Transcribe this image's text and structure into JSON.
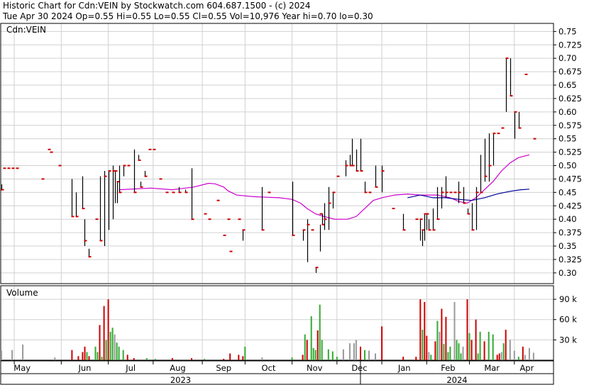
{
  "header": {
    "line1": "Historic Chart for Cdn:VEIN by Stockwatch.com 604.687.1500 - (c) 2024",
    "line2": "Tue Apr 30 2024  Op=0.55  Hi=0.55  Lo=0.55  Cl=0.55  Vol=10,976  Year hi=0.70  lo=0.30"
  },
  "chart_data": {
    "type": "ohlc",
    "symbol_label": "Cdn:VEIN",
    "volume_label": "Volume",
    "price_ylim": [
      0.28,
      0.765
    ],
    "price_ticks": [
      0.75,
      0.725,
      0.7,
      0.675,
      0.65,
      0.625,
      0.6,
      0.575,
      0.55,
      0.525,
      0.5,
      0.475,
      0.45,
      0.425,
      0.4,
      0.375,
      0.35,
      0.325,
      0.3
    ],
    "price_tick_labels": [
      "0.75",
      "0.725",
      "0.70",
      "0.675",
      "0.65",
      "0.625",
      "0.60",
      "0.575",
      "0.55",
      "0.525",
      "0.50",
      "0.475",
      "0.45",
      "0.425",
      "0.40",
      "0.375",
      "0.35",
      "0.325",
      "0.30"
    ],
    "volume_ylim": [
      0,
      110000
    ],
    "volume_ticks": [
      90000,
      60000,
      30000
    ],
    "volume_tick_labels": [
      "90 k",
      "60 k",
      "30 k"
    ],
    "month_labels": [
      "May",
      "Jun",
      "Jul",
      "Aug",
      "Sep",
      "Oct",
      "Nov",
      "Dec",
      "Jan",
      "Feb",
      "Mar",
      "Apr"
    ],
    "year_labels": [
      "2023",
      "2024"
    ],
    "colors": {
      "up_close": "#cc0000",
      "price_bar": "#000000",
      "ma_short": "#cc00cc",
      "ma_long": "#000099",
      "vol_up": "#33aa33",
      "vol_down": "#cc0000",
      "vol_flat": "#999999",
      "grid": "#d0d0d0"
    },
    "x_range": [
      0,
      258
    ],
    "month_starts": [
      6,
      28,
      50,
      71,
      94,
      114,
      136,
      157,
      178,
      199,
      219,
      240
    ],
    "year_boundary_index": 168,
    "ohlc": [
      [
        0,
        0.465,
        0.455,
        0.455
      ],
      [
        1,
        0.495,
        0.495,
        0.495
      ],
      [
        3,
        0.495,
        0.495,
        0.495
      ],
      [
        5,
        0.495,
        0.495,
        0.495
      ],
      [
        7,
        0.495,
        0.495,
        0.495
      ],
      [
        19,
        0.475,
        0.475,
        0.475
      ],
      [
        22,
        0.53,
        0.53,
        0.53
      ],
      [
        23,
        0.525,
        0.525,
        0.525
      ],
      [
        27,
        0.5,
        0.5,
        0.5
      ],
      [
        33,
        0.475,
        0.405,
        0.405
      ],
      [
        35,
        0.45,
        0.405,
        0.405
      ],
      [
        38,
        0.48,
        0.42,
        0.42
      ],
      [
        39,
        0.4,
        0.35,
        0.36
      ],
      [
        41,
        0.345,
        0.33,
        0.33
      ],
      [
        44,
        0.4,
        0.4,
        0.4
      ],
      [
        46,
        0.48,
        0.36,
        0.36
      ],
      [
        48,
        0.49,
        0.35,
        0.48
      ],
      [
        50,
        0.49,
        0.38,
        0.49
      ],
      [
        52,
        0.5,
        0.4,
        0.49
      ],
      [
        53,
        0.49,
        0.43,
        0.49
      ],
      [
        54,
        0.47,
        0.43,
        0.47
      ],
      [
        55,
        0.5,
        0.45,
        0.45
      ],
      [
        57,
        0.5,
        0.48,
        0.5
      ],
      [
        59,
        0.5,
        0.5,
        0.5
      ],
      [
        62,
        0.53,
        0.45,
        0.45
      ],
      [
        64,
        0.52,
        0.51,
        0.51
      ],
      [
        65,
        0.47,
        0.46,
        0.46
      ],
      [
        67,
        0.49,
        0.48,
        0.48
      ],
      [
        69,
        0.53,
        0.53,
        0.53
      ],
      [
        71,
        0.53,
        0.53,
        0.53
      ],
      [
        74,
        0.475,
        0.475,
        0.475
      ],
      [
        77,
        0.45,
        0.45,
        0.45
      ],
      [
        80,
        0.45,
        0.45,
        0.45
      ],
      [
        83,
        0.46,
        0.45,
        0.45
      ],
      [
        86,
        0.455,
        0.45,
        0.45
      ],
      [
        89,
        0.495,
        0.4,
        0.4
      ],
      [
        95,
        0.41,
        0.41,
        0.41
      ],
      [
        97,
        0.4,
        0.4,
        0.4
      ],
      [
        101,
        0.435,
        0.435,
        0.435
      ],
      [
        104,
        0.37,
        0.37,
        0.37
      ],
      [
        106,
        0.4,
        0.4,
        0.4
      ],
      [
        107,
        0.34,
        0.34,
        0.34
      ],
      [
        111,
        0.4,
        0.4,
        0.4
      ],
      [
        113,
        0.38,
        0.36,
        0.38
      ],
      [
        122,
        0.46,
        0.38,
        0.38
      ],
      [
        125,
        0.45,
        0.45,
        0.45
      ],
      [
        136,
        0.47,
        0.37,
        0.37
      ],
      [
        141,
        0.38,
        0.36,
        0.38
      ],
      [
        143,
        0.4,
        0.32,
        0.39
      ],
      [
        145,
        0.38,
        0.38,
        0.38
      ],
      [
        147,
        0.31,
        0.3,
        0.31
      ],
      [
        149,
        0.39,
        0.34,
        0.41
      ],
      [
        150,
        0.41,
        0.39,
        0.39
      ],
      [
        151,
        0.43,
        0.38,
        0.4
      ],
      [
        153,
        0.46,
        0.38,
        0.43
      ],
      [
        155,
        0.45,
        0.42,
        0.45
      ],
      [
        157,
        0.48,
        0.48,
        0.48
      ],
      [
        161,
        0.51,
        0.48,
        0.5
      ],
      [
        163,
        0.52,
        0.5,
        0.5
      ],
      [
        164,
        0.55,
        0.5,
        0.5
      ],
      [
        166,
        0.53,
        0.49,
        0.49
      ],
      [
        168,
        0.55,
        0.49,
        0.49
      ],
      [
        170,
        0.47,
        0.45,
        0.45
      ],
      [
        172,
        0.45,
        0.45,
        0.45
      ],
      [
        175,
        0.5,
        0.46,
        0.46
      ],
      [
        178,
        0.5,
        0.45,
        0.49
      ],
      [
        183,
        0.42,
        0.42,
        0.42
      ],
      [
        188,
        0.41,
        0.38,
        0.38
      ],
      [
        194,
        0.4,
        0.4,
        0.4
      ],
      [
        196,
        0.4,
        0.36,
        0.4
      ],
      [
        197,
        0.38,
        0.35,
        0.38
      ],
      [
        198,
        0.41,
        0.36,
        0.41
      ],
      [
        199,
        0.41,
        0.38,
        0.41
      ],
      [
        200,
        0.4,
        0.38,
        0.38
      ],
      [
        202,
        0.42,
        0.38,
        0.38
      ],
      [
        204,
        0.46,
        0.4,
        0.4
      ],
      [
        206,
        0.46,
        0.42,
        0.45
      ],
      [
        208,
        0.48,
        0.44,
        0.45
      ],
      [
        210,
        0.45,
        0.45,
        0.45
      ],
      [
        212,
        0.45,
        0.45,
        0.45
      ],
      [
        214,
        0.47,
        0.43,
        0.45
      ],
      [
        216,
        0.46,
        0.43,
        0.43
      ],
      [
        218,
        0.42,
        0.41,
        0.41
      ],
      [
        220,
        0.43,
        0.38,
        0.38
      ],
      [
        222,
        0.46,
        0.38,
        0.45
      ],
      [
        224,
        0.52,
        0.45,
        0.45
      ],
      [
        226,
        0.55,
        0.47,
        0.48
      ],
      [
        228,
        0.56,
        0.47,
        0.5
      ],
      [
        230,
        0.56,
        0.5,
        0.56
      ],
      [
        232,
        0.56,
        0.56,
        0.56
      ],
      [
        234,
        0.57,
        0.57,
        0.57
      ],
      [
        236,
        0.7,
        0.6,
        0.7
      ],
      [
        238,
        0.7,
        0.63,
        0.63
      ],
      [
        240,
        0.6,
        0.55,
        0.6
      ],
      [
        242,
        0.6,
        0.57,
        0.57
      ],
      [
        245,
        0.67,
        0.67,
        0.67
      ],
      [
        249,
        0.55,
        0.55,
        0.55
      ]
    ],
    "ma_short": [
      [
        55,
        0.455
      ],
      [
        70,
        0.458
      ],
      [
        80,
        0.455
      ],
      [
        90,
        0.46
      ],
      [
        97,
        0.467
      ],
      [
        100,
        0.466
      ],
      [
        104,
        0.46
      ],
      [
        106,
        0.453
      ],
      [
        110,
        0.445
      ],
      [
        118,
        0.442
      ],
      [
        130,
        0.44
      ],
      [
        136,
        0.437
      ],
      [
        140,
        0.43
      ],
      [
        143,
        0.42
      ],
      [
        147,
        0.41
      ],
      [
        151,
        0.405
      ],
      [
        156,
        0.4
      ],
      [
        162,
        0.4
      ],
      [
        166,
        0.405
      ],
      [
        170,
        0.42
      ],
      [
        174,
        0.435
      ],
      [
        178,
        0.44
      ],
      [
        184,
        0.445
      ],
      [
        190,
        0.447
      ],
      [
        196,
        0.445
      ],
      [
        204,
        0.445
      ],
      [
        210,
        0.44
      ],
      [
        214,
        0.433
      ],
      [
        218,
        0.43
      ],
      [
        222,
        0.44
      ],
      [
        226,
        0.455
      ],
      [
        230,
        0.47
      ],
      [
        234,
        0.49
      ],
      [
        238,
        0.505
      ],
      [
        242,
        0.515
      ],
      [
        247,
        0.52
      ]
    ],
    "ma_long": [
      [
        190,
        0.44
      ],
      [
        196,
        0.445
      ],
      [
        202,
        0.44
      ],
      [
        208,
        0.44
      ],
      [
        214,
        0.437
      ],
      [
        220,
        0.435
      ],
      [
        226,
        0.44
      ],
      [
        232,
        0.447
      ],
      [
        238,
        0.452
      ],
      [
        243,
        0.455
      ],
      [
        247,
        0.456
      ]
    ],
    "volume": [
      [
        0,
        14000,
        "flat"
      ],
      [
        5,
        15000,
        "flat"
      ],
      [
        10,
        23000,
        "flat"
      ],
      [
        25,
        4000,
        "flat"
      ],
      [
        33,
        15000,
        "down"
      ],
      [
        36,
        6000,
        "down"
      ],
      [
        38,
        12000,
        "down"
      ],
      [
        39,
        20000,
        "down"
      ],
      [
        40,
        12000,
        "up"
      ],
      [
        41,
        6000,
        "down"
      ],
      [
        44,
        20000,
        "up"
      ],
      [
        45,
        12000,
        "up"
      ],
      [
        46,
        52000,
        "down"
      ],
      [
        47,
        5000,
        "up"
      ],
      [
        48,
        80000,
        "down"
      ],
      [
        49,
        30000,
        "up"
      ],
      [
        50,
        90000,
        "down"
      ],
      [
        51,
        42000,
        "up"
      ],
      [
        52,
        48000,
        "up"
      ],
      [
        53,
        38000,
        "flat"
      ],
      [
        54,
        26000,
        "up"
      ],
      [
        55,
        20000,
        "up"
      ],
      [
        57,
        15000,
        "up"
      ],
      [
        59,
        8000,
        "down"
      ],
      [
        62,
        3000,
        "down"
      ],
      [
        68,
        3000,
        "up"
      ],
      [
        72,
        2000,
        "up"
      ],
      [
        80,
        3000,
        "down"
      ],
      [
        89,
        3000,
        "down"
      ],
      [
        95,
        2000,
        "up"
      ],
      [
        104,
        2000,
        "down"
      ],
      [
        107,
        10000,
        "down"
      ],
      [
        111,
        8000,
        "down"
      ],
      [
        113,
        6000,
        "down"
      ],
      [
        114,
        20000,
        "up"
      ],
      [
        122,
        4000,
        "flat"
      ],
      [
        136,
        4000,
        "up"
      ],
      [
        141,
        8000,
        "down"
      ],
      [
        142,
        38000,
        "up"
      ],
      [
        143,
        30000,
        "down"
      ],
      [
        145,
        65000,
        "up"
      ],
      [
        146,
        18000,
        "up"
      ],
      [
        147,
        15000,
        "up"
      ],
      [
        148,
        44000,
        "down"
      ],
      [
        149,
        82000,
        "up"
      ],
      [
        150,
        30000,
        "up"
      ],
      [
        153,
        16000,
        "up"
      ],
      [
        155,
        13000,
        "up"
      ],
      [
        157,
        5000,
        "up"
      ],
      [
        160,
        16000,
        "flat"
      ],
      [
        163,
        25000,
        "flat"
      ],
      [
        165,
        25000,
        "flat"
      ],
      [
        166,
        30000,
        "flat"
      ],
      [
        168,
        20000,
        "down"
      ],
      [
        170,
        15000,
        "up"
      ],
      [
        172,
        14000,
        "flat"
      ],
      [
        175,
        10000,
        "flat"
      ],
      [
        178,
        50000,
        "down"
      ],
      [
        188,
        5000,
        "down"
      ],
      [
        194,
        5000,
        "down"
      ],
      [
        196,
        90000,
        "down"
      ],
      [
        197,
        45000,
        "up"
      ],
      [
        198,
        86000,
        "down"
      ],
      [
        199,
        36000,
        "down"
      ],
      [
        200,
        12000,
        "flat"
      ],
      [
        201,
        8000,
        "up"
      ],
      [
        203,
        28000,
        "down"
      ],
      [
        204,
        58000,
        "up"
      ],
      [
        205,
        42000,
        "flat"
      ],
      [
        206,
        76000,
        "down"
      ],
      [
        207,
        24000,
        "up"
      ],
      [
        208,
        64000,
        "down"
      ],
      [
        209,
        12000,
        "up"
      ],
      [
        210,
        20000,
        "up"
      ],
      [
        212,
        86000,
        "flat"
      ],
      [
        213,
        30000,
        "up"
      ],
      [
        214,
        25000,
        "up"
      ],
      [
        215,
        10000,
        "up"
      ],
      [
        216,
        20000,
        "flat"
      ],
      [
        218,
        90000,
        "down"
      ],
      [
        219,
        40000,
        "up"
      ],
      [
        220,
        30000,
        "down"
      ],
      [
        222,
        60000,
        "down"
      ],
      [
        223,
        10000,
        "up"
      ],
      [
        224,
        42000,
        "up"
      ],
      [
        226,
        28000,
        "down"
      ],
      [
        228,
        42000,
        "up"
      ],
      [
        230,
        38000,
        "up"
      ],
      [
        232,
        8000,
        "down"
      ],
      [
        233,
        10000,
        "down"
      ],
      [
        234,
        12000,
        "flat"
      ],
      [
        235,
        25000,
        "up"
      ],
      [
        236,
        45000,
        "down"
      ],
      [
        238,
        30000,
        "flat"
      ],
      [
        240,
        14000,
        "flat"
      ],
      [
        242,
        5000,
        "up"
      ],
      [
        244,
        20000,
        "down"
      ],
      [
        245,
        8000,
        "flat"
      ],
      [
        247,
        18000,
        "flat"
      ],
      [
        249,
        11000,
        "flat"
      ]
    ]
  }
}
